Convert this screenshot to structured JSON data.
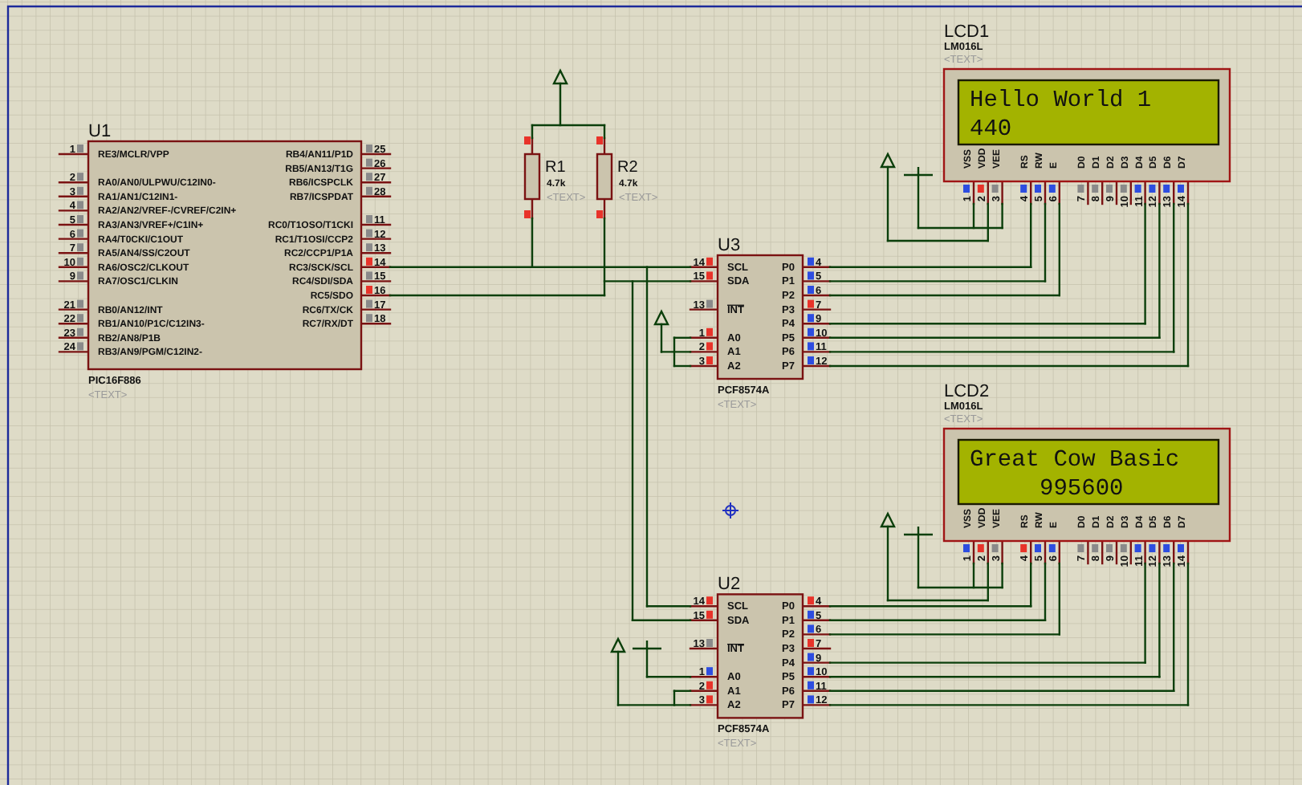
{
  "schematic": {
    "u1": {
      "ref": "U1",
      "part": "PIC16F886",
      "text": "<TEXT>",
      "left_pins": [
        {
          "number": "1",
          "label": "RE3/MCLR/VPP",
          "color": "#8a8a8a"
        },
        {
          "number": "2",
          "label": "RA0/AN0/ULPWU/C12IN0-",
          "color": "#8a8a8a"
        },
        {
          "number": "3",
          "label": "RA1/AN1/C12IN1-",
          "color": "#8a8a8a"
        },
        {
          "number": "4",
          "label": "RA2/AN2/VREF-/CVREF/C2IN+",
          "color": "#8a8a8a"
        },
        {
          "number": "5",
          "label": "RA3/AN3/VREF+/C1IN+",
          "color": "#8a8a8a"
        },
        {
          "number": "6",
          "label": "RA4/T0CKI/C1OUT",
          "color": "#8a8a8a"
        },
        {
          "number": "7",
          "label": "RA5/AN4/SS/C2OUT",
          "color": "#8a8a8a"
        },
        {
          "number": "10",
          "label": "RA6/OSC2/CLKOUT",
          "color": "#8a8a8a"
        },
        {
          "number": "9",
          "label": "RA7/OSC1/CLKIN",
          "color": "#8a8a8a"
        },
        {
          "number": "21",
          "label": "RB0/AN12/INT",
          "color": "#8a8a8a"
        },
        {
          "number": "22",
          "label": "RB1/AN10/P1C/C12IN3-",
          "color": "#8a8a8a"
        },
        {
          "number": "23",
          "label": "RB2/AN8/P1B",
          "color": "#8a8a8a"
        },
        {
          "number": "24",
          "label": "RB3/AN9/PGM/C12IN2-",
          "color": "#8a8a8a"
        }
      ],
      "right_pins": [
        {
          "number": "25",
          "label": "RB4/AN11/P1D",
          "color": "#8a8a8a"
        },
        {
          "number": "26",
          "label": "RB5/AN13/T1G",
          "color": "#8a8a8a"
        },
        {
          "number": "27",
          "label": "RB6/ICSPCLK",
          "color": "#8a8a8a"
        },
        {
          "number": "28",
          "label": "RB7/ICSPDAT",
          "color": "#8a8a8a"
        },
        {
          "number": "11",
          "label": "RC0/T1OSO/T1CKI",
          "color": "#8a8a8a"
        },
        {
          "number": "12",
          "label": "RC1/T1OSI/CCP2",
          "color": "#8a8a8a"
        },
        {
          "number": "13",
          "label": "RC2/CCP1/P1A",
          "color": "#8a8a8a"
        },
        {
          "number": "14",
          "label": "RC3/SCK/SCL",
          "color": "#e8332a"
        },
        {
          "number": "15",
          "label": "RC4/SDI/SDA",
          "color": "#8a8a8a"
        },
        {
          "number": "16",
          "label": "RC5/SDO",
          "color": "#e8332a"
        },
        {
          "number": "17",
          "label": "RC6/TX/CK",
          "color": "#8a8a8a"
        },
        {
          "number": "18",
          "label": "RC7/RX/DT",
          "color": "#8a8a8a"
        }
      ]
    },
    "resistors": [
      {
        "ref": "R1",
        "value": "4.7k",
        "text": "<TEXT>",
        "pins": [
          {
            "color": "#e8332a"
          },
          {
            "color": "#e8332a"
          }
        ]
      },
      {
        "ref": "R2",
        "value": "4.7k",
        "text": "<TEXT>",
        "pins": [
          {
            "color": "#e8332a"
          },
          {
            "color": "#e8332a"
          }
        ]
      }
    ],
    "expanders": [
      {
        "ref": "U3",
        "part": "PCF8574A",
        "text": "<TEXT>",
        "left_pins": [
          {
            "number": "14",
            "label": "SCL",
            "color": "#e8332a",
            "inverted": false
          },
          {
            "number": "15",
            "label": "SDA",
            "color": "#e8332a",
            "inverted": false
          },
          {
            "number": "13",
            "label": "INT",
            "color": "#8a8a8a",
            "inverted": true
          },
          {
            "number": "1",
            "label": "A0",
            "color": "#e8332a",
            "inverted": false
          },
          {
            "number": "2",
            "label": "A1",
            "color": "#e8332a",
            "inverted": false
          },
          {
            "number": "3",
            "label": "A2",
            "color": "#e8332a",
            "inverted": false
          }
        ],
        "right_pins": [
          {
            "number": "4",
            "label": "P0",
            "color": "#2d4de0",
            "inverted": false
          },
          {
            "number": "5",
            "label": "P1",
            "color": "#2d4de0",
            "inverted": false
          },
          {
            "number": "6",
            "label": "P2",
            "color": "#2d4de0",
            "inverted": false
          },
          {
            "number": "7",
            "label": "P3",
            "color": "#e8332a",
            "inverted": false
          },
          {
            "number": "9",
            "label": "P4",
            "color": "#2d4de0",
            "inverted": false
          },
          {
            "number": "10",
            "label": "P5",
            "color": "#2d4de0",
            "inverted": false
          },
          {
            "number": "11",
            "label": "P6",
            "color": "#2d4de0",
            "inverted": false
          },
          {
            "number": "12",
            "label": "P7",
            "color": "#2d4de0",
            "inverted": false
          }
        ]
      },
      {
        "ref": "U2",
        "part": "PCF8574A",
        "text": "<TEXT>",
        "left_pins": [
          {
            "number": "14",
            "label": "SCL",
            "color": "#e8332a",
            "inverted": false
          },
          {
            "number": "15",
            "label": "SDA",
            "color": "#e8332a",
            "inverted": false
          },
          {
            "number": "13",
            "label": "INT",
            "color": "#8a8a8a",
            "inverted": true
          },
          {
            "number": "1",
            "label": "A0",
            "color": "#2d4de0",
            "inverted": false
          },
          {
            "number": "2",
            "label": "A1",
            "color": "#e8332a",
            "inverted": false
          },
          {
            "number": "3",
            "label": "A2",
            "color": "#e8332a",
            "inverted": false
          }
        ],
        "right_pins": [
          {
            "number": "4",
            "label": "P0",
            "color": "#e8332a",
            "inverted": false
          },
          {
            "number": "5",
            "label": "P1",
            "color": "#2d4de0",
            "inverted": false
          },
          {
            "number": "6",
            "label": "P2",
            "color": "#2d4de0",
            "inverted": false
          },
          {
            "number": "7",
            "label": "P3",
            "color": "#e8332a",
            "inverted": false
          },
          {
            "number": "9",
            "label": "P4",
            "color": "#2d4de0",
            "inverted": false
          },
          {
            "number": "10",
            "label": "P5",
            "color": "#2d4de0",
            "inverted": false
          },
          {
            "number": "11",
            "label": "P6",
            "color": "#2d4de0",
            "inverted": false
          },
          {
            "number": "12",
            "label": "P7",
            "color": "#2d4de0",
            "inverted": false
          }
        ]
      }
    ],
    "lcds": [
      {
        "ref": "LCD1",
        "part": "LM016L",
        "text": "<TEXT>",
        "lines": [
          "Hello World 1",
          "440"
        ],
        "pins": [
          {
            "number": "1",
            "label": "VSS",
            "color": "#2d4de0"
          },
          {
            "number": "2",
            "label": "VDD",
            "color": "#e8332a"
          },
          {
            "number": "3",
            "label": "VEE",
            "color": "#8a8a8a"
          },
          {
            "number": "4",
            "label": "RS",
            "color": "#2d4de0"
          },
          {
            "number": "5",
            "label": "RW",
            "color": "#2d4de0"
          },
          {
            "number": "6",
            "label": "E",
            "color": "#2d4de0"
          },
          {
            "number": "7",
            "label": "D0",
            "color": "#8a8a8a"
          },
          {
            "number": "8",
            "label": "D1",
            "color": "#8a8a8a"
          },
          {
            "number": "9",
            "label": "D2",
            "color": "#8a8a8a"
          },
          {
            "number": "10",
            "label": "D3",
            "color": "#8a8a8a"
          },
          {
            "number": "11",
            "label": "D4",
            "color": "#2d4de0"
          },
          {
            "number": "12",
            "label": "D5",
            "color": "#2d4de0"
          },
          {
            "number": "13",
            "label": "D6",
            "color": "#2d4de0"
          },
          {
            "number": "14",
            "label": "D7",
            "color": "#2d4de0"
          }
        ]
      },
      {
        "ref": "LCD2",
        "part": "LM016L",
        "text": "<TEXT>",
        "lines": [
          "Great Cow Basic",
          "     995600"
        ],
        "pins": [
          {
            "number": "1",
            "label": "VSS",
            "color": "#2d4de0"
          },
          {
            "number": "2",
            "label": "VDD",
            "color": "#e8332a"
          },
          {
            "number": "3",
            "label": "VEE",
            "color": "#8a8a8a"
          },
          {
            "number": "4",
            "label": "RS",
            "color": "#e8332a"
          },
          {
            "number": "5",
            "label": "RW",
            "color": "#2d4de0"
          },
          {
            "number": "6",
            "label": "E",
            "color": "#2d4de0"
          },
          {
            "number": "7",
            "label": "D0",
            "color": "#8a8a8a"
          },
          {
            "number": "8",
            "label": "D1",
            "color": "#8a8a8a"
          },
          {
            "number": "9",
            "label": "D2",
            "color": "#8a8a8a"
          },
          {
            "number": "10",
            "label": "D3",
            "color": "#8a8a8a"
          },
          {
            "number": "11",
            "label": "D4",
            "color": "#2d4de0"
          },
          {
            "number": "12",
            "label": "D5",
            "color": "#2d4de0"
          },
          {
            "number": "13",
            "label": "D6",
            "color": "#2d4de0"
          },
          {
            "number": "14",
            "label": "D7",
            "color": "#2d4de0"
          }
        ]
      }
    ]
  }
}
